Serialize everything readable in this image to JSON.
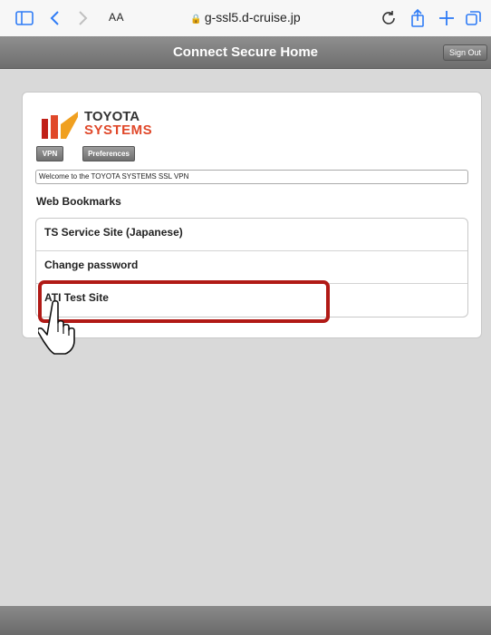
{
  "browser": {
    "font_size_label": "AA",
    "url": "g-ssl5.d-cruise.jp",
    "icons": [
      "sidebar-icon",
      "back-icon",
      "forward-icon",
      "lock-icon",
      "reload-icon",
      "share-icon",
      "new-tab-icon",
      "tabs-icon"
    ]
  },
  "header": {
    "title": "Connect Secure Home",
    "sign_out_label": "Sign Out"
  },
  "logo": {
    "line1": "TOYOTA",
    "line2": "SYSTEMS",
    "colors": [
      "#e0482a",
      "#f0a020",
      "#c02018"
    ]
  },
  "tabs": {
    "vpn_label": "VPN",
    "preferences_label": "Preferences"
  },
  "welcome_text": "Welcome to the TOYOTA SYSTEMS SSL VPN",
  "bookmarks": {
    "heading": "Web Bookmarks",
    "items": [
      {
        "label": "TS Service Site (Japanese)"
      },
      {
        "label": "Change password"
      },
      {
        "label": "ATI Test Site"
      }
    ]
  },
  "annotation": {
    "highlight_color": "#b11a16",
    "highlighted_item": "ATI Test Site"
  }
}
